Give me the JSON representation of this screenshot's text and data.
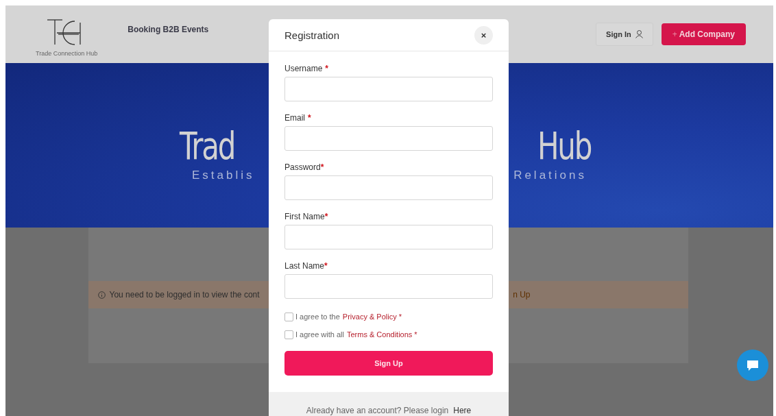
{
  "header": {
    "logo_caption": "Trade Connection Hub",
    "nav": [
      "Booking B2B Events"
    ],
    "sign_in": "Sign In",
    "add_company": {
      "icon": "+",
      "label": "Add Company"
    }
  },
  "hero": {
    "title_left": "Trad",
    "title_right": "Hub",
    "subtitle_left": "Establis",
    "subtitle_right": "Relations"
  },
  "notice": {
    "text_left": "You need to be logged in to view the cont",
    "text_right": "n Up"
  },
  "modal": {
    "title": "Registration",
    "close": "×",
    "fields": [
      {
        "label": "Username",
        "mark": "*",
        "spaced": true
      },
      {
        "label": "Email",
        "mark": "*",
        "spaced": true
      },
      {
        "label": "Password",
        "mark": "*",
        "spaced": false
      },
      {
        "label": "First Name",
        "mark": "*",
        "spaced": false
      },
      {
        "label": "Last Name",
        "mark": "*",
        "spaced": false
      }
    ],
    "agreements": [
      {
        "text": "I agree to the",
        "link": "Privacy & Policy *",
        "checked": false
      },
      {
        "text": "I agree with all",
        "link": "Terms & Conditions *",
        "checked": false
      }
    ],
    "submit": "Sign Up",
    "footer_text": "Already have an account? Please login",
    "footer_link": "Here"
  }
}
